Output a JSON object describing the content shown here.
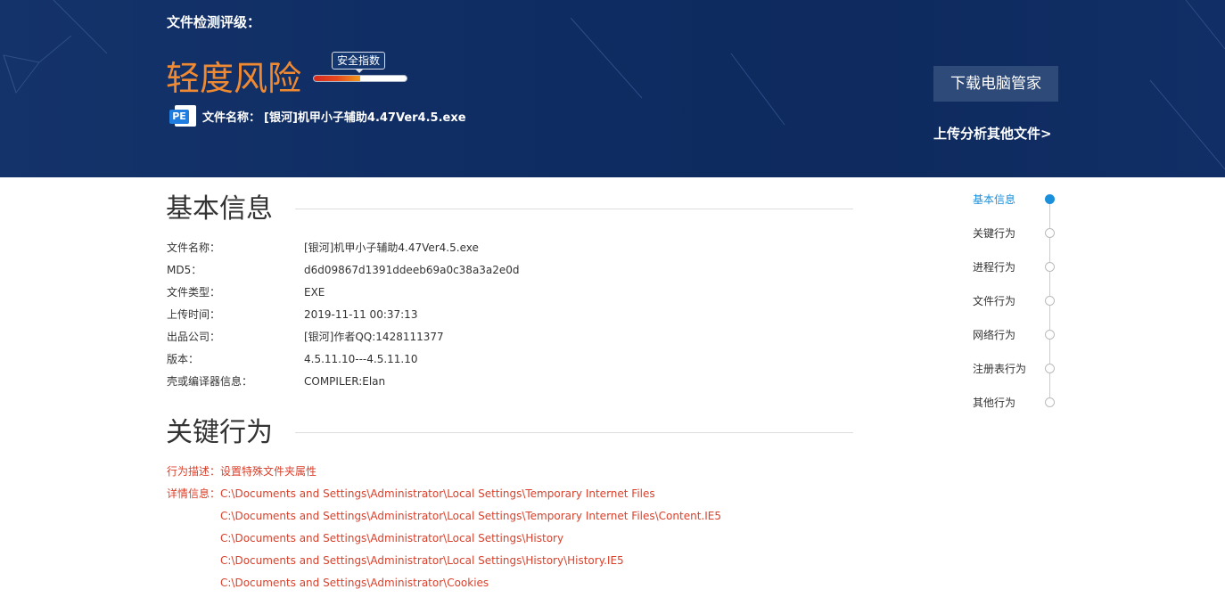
{
  "header": {
    "label": "文件检测评级：",
    "risk_level": "轻度风险",
    "score_tag": "安全指数",
    "score_fraction": 0.5,
    "file_badge": "PE",
    "file_name_key": "文件名称：",
    "file_name_value": "[银河]机甲小子辅助4.47Ver4.5.exe",
    "download_button": "下载电脑管家",
    "upload_link": "上传分析其他文件>"
  },
  "basic_info": {
    "title": "基本信息",
    "rows": [
      {
        "key": "文件名称：",
        "value": "[银河]机甲小子辅助4.47Ver4.5.exe"
      },
      {
        "key": "MD5：",
        "value": "d6d09867d1391ddeeb69a0c38a3a2e0d"
      },
      {
        "key": "文件类型：",
        "value": "EXE"
      },
      {
        "key": "上传时间：",
        "value": "2019-11-11 00:37:13"
      },
      {
        "key": "出品公司：",
        "value": "[银河]作者QQ:1428111377"
      },
      {
        "key": "版本：",
        "value": "4.5.11.10---4.5.11.10"
      },
      {
        "key": "壳或编译器信息：",
        "value": "COMPILER:Elan"
      }
    ]
  },
  "key_behavior": {
    "title": "关键行为",
    "desc_label": "行为描述：设置特殊文件夹属性",
    "detail_label": "详情信息：",
    "details": [
      "C:\\Documents and Settings\\Administrator\\Local Settings\\Temporary Internet Files",
      "C:\\Documents and Settings\\Administrator\\Local Settings\\Temporary Internet Files\\Content.IE5",
      "C:\\Documents and Settings\\Administrator\\Local Settings\\History",
      "C:\\Documents and Settings\\Administrator\\Local Settings\\History\\History.IE5",
      "C:\\Documents and Settings\\Administrator\\Cookies"
    ]
  },
  "side_nav": {
    "items": [
      {
        "label": "基本信息",
        "active": true
      },
      {
        "label": "关键行为",
        "active": false
      },
      {
        "label": "进程行为",
        "active": false
      },
      {
        "label": "文件行为",
        "active": false
      },
      {
        "label": "网络行为",
        "active": false
      },
      {
        "label": "注册表行为",
        "active": false
      },
      {
        "label": "其他行为",
        "active": false
      }
    ]
  },
  "colors": {
    "banner": "#0f2d63",
    "risk": "#f08a32",
    "behavior_text": "#d9412c",
    "nav_active": "#1a8fdb"
  }
}
